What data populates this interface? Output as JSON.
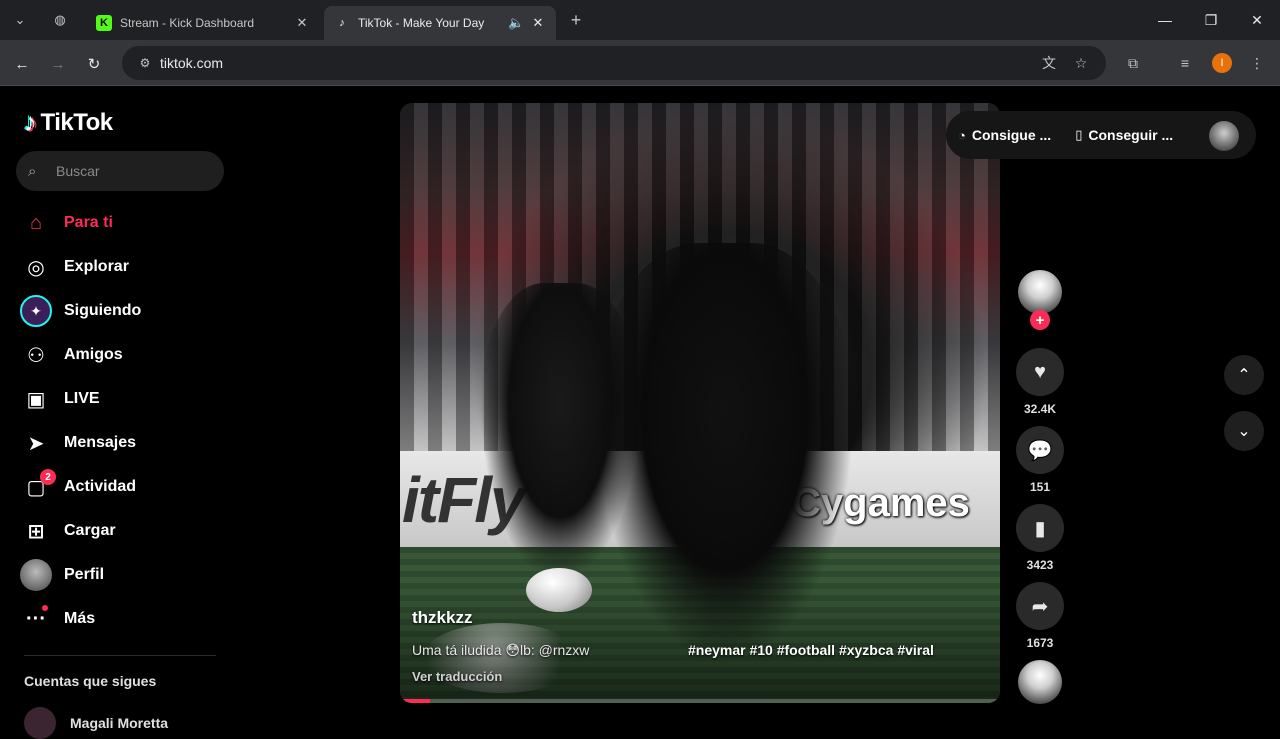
{
  "browser": {
    "tabs": [
      {
        "title": "Stream - Kick Dashboard",
        "favicon": "K",
        "favicon_color": "#53fc18",
        "active": false
      },
      {
        "title": "TikTok - Make Your Day",
        "favicon": "♪",
        "favicon_color": "#ffffff",
        "active": true
      }
    ],
    "url": "tiktok.com",
    "profile_initial": "I"
  },
  "sidebar": {
    "logo": "TikTok",
    "search_placeholder": "Buscar",
    "nav": [
      {
        "label": "Para ti",
        "icon": "home-icon",
        "active": true
      },
      {
        "label": "Explorar",
        "icon": "compass-icon",
        "active": false
      },
      {
        "label": "Siguiendo",
        "icon": "following-icon",
        "active": false
      },
      {
        "label": "Amigos",
        "icon": "friends-icon",
        "active": false
      },
      {
        "label": "LIVE",
        "icon": "live-icon",
        "active": false
      },
      {
        "label": "Mensajes",
        "icon": "messages-icon",
        "active": false
      },
      {
        "label": "Actividad",
        "icon": "activity-icon",
        "active": false,
        "badge": "2"
      },
      {
        "label": "Cargar",
        "icon": "upload-icon",
        "active": false
      },
      {
        "label": "Perfil",
        "icon": "profile-icon",
        "active": false
      },
      {
        "label": "Más",
        "icon": "more-icon",
        "active": false
      }
    ],
    "following_heading": "Cuentas que sigues",
    "following_accounts": [
      "Magali Moretta"
    ]
  },
  "video": {
    "author": "thzkkzz",
    "description": "Uma tá iludida 😳lb: @rnzxw",
    "hashtags": "#neymar #10 #football #xyzbca #viral",
    "translate": "Ver traducción",
    "ad_left": "itFly",
    "ad_right": "Cygames",
    "progress": 0.05
  },
  "topbar": {
    "coins_label": "Consigue ...",
    "app_label": "Conseguir ..."
  },
  "actions": {
    "likes": "32.4K",
    "comments": "151",
    "saves": "3423",
    "shares": "1673"
  },
  "colors": {
    "accent": "#fe2c55",
    "background": "#000000"
  }
}
